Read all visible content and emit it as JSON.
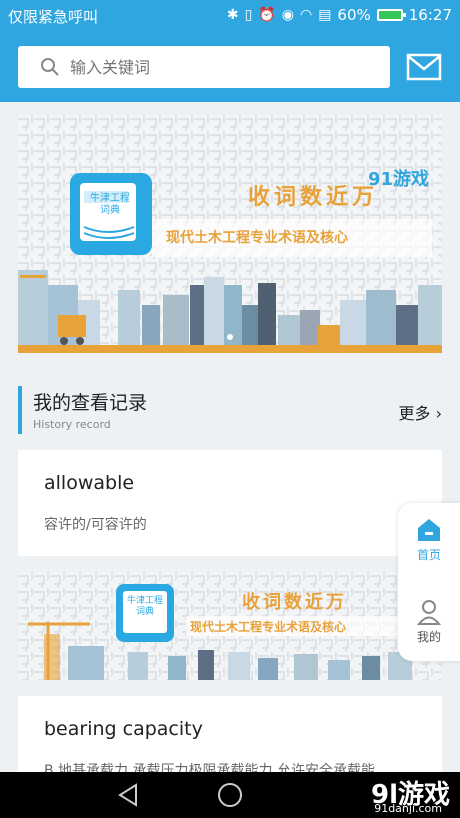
{
  "status": {
    "carrier": "仅限紧急呼叫",
    "battery": "60%",
    "time": "16:27"
  },
  "search": {
    "placeholder": "输入关键词"
  },
  "banner": {
    "app_name": "牛津工程词典",
    "title": "收词数近万",
    "subtitle": "现代土木工程专业术语及核心",
    "logo_text": "91游戏"
  },
  "history": {
    "title": "我的查看记录",
    "subtitle": "History record",
    "more": "更多"
  },
  "entries": [
    {
      "word": "allowable",
      "meaning": "容许的/可容许的"
    },
    {
      "word": "bearing capacity",
      "meaning": "B 地基承载力 承载压力极限承载能力 允许安全承载能"
    }
  ],
  "fab": {
    "home": "首页",
    "mine": "我的"
  },
  "watermark": {
    "brand": "9l游戏",
    "site": "91danji.com"
  },
  "colors": {
    "accent": "#2fa6e0",
    "banner_orange": "#e8a23a"
  }
}
